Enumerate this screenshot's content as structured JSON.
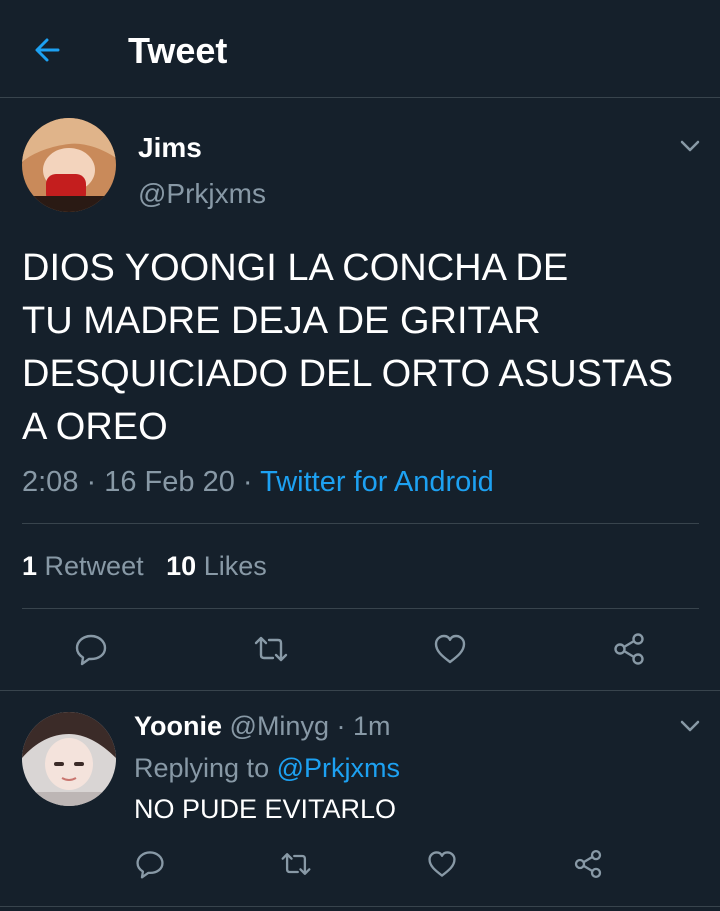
{
  "header": {
    "title": "Tweet"
  },
  "tweet": {
    "author_name": "Jims",
    "author_handle": "@Prkjxms",
    "text_lines": [
      "DIOS YOONGI LA CONCHA DE",
      "TU MADRE DEJA DE GRITAR",
      "DESQUICIADO DEL ORTO ASUSTAS",
      "A OREO"
    ],
    "time": "2:08",
    "sep1": " · ",
    "date": "16 Feb 20",
    "sep2": " · ",
    "source": "Twitter for Android",
    "retweet_count": "1",
    "retweet_label": "Retweet",
    "like_count": "10",
    "like_label": "Likes"
  },
  "reply": {
    "author_name": "Yoonie",
    "author_handle": "@Minyg",
    "sep": " · ",
    "age": "1m",
    "replying_label": "Replying to",
    "replying_to": "@Prkjxms",
    "text": "NO PUDE EVITARLO"
  },
  "icons": {
    "back": "arrow-left-icon",
    "menu": "chevron-down-icon",
    "reply": "comment-icon",
    "retweet": "retweet-icon",
    "like": "heart-icon",
    "share": "share-icon"
  },
  "colors": {
    "background": "#15202b",
    "accent": "#1da1f2",
    "muted": "#8899a6",
    "divider": "#38444d"
  }
}
